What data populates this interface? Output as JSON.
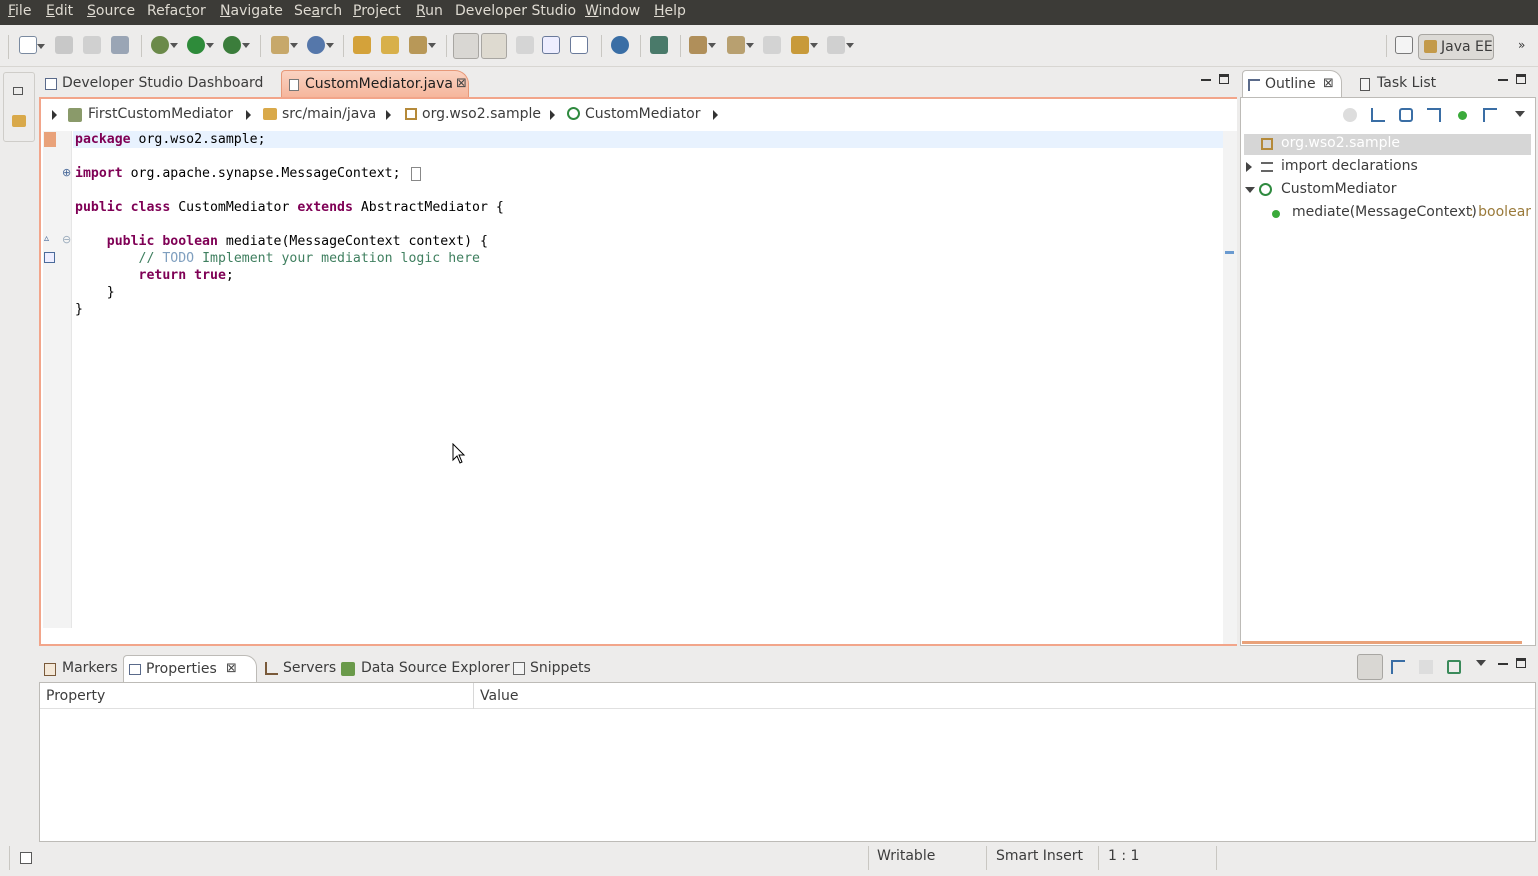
{
  "menubar": {
    "items": [
      {
        "label": "File",
        "mnemonic": "F"
      },
      {
        "label": "Edit",
        "mnemonic": "E"
      },
      {
        "label": "Source",
        "mnemonic": "S"
      },
      {
        "label": "Refactor",
        "mnemonic": "t"
      },
      {
        "label": "Navigate",
        "mnemonic": "N"
      },
      {
        "label": "Search",
        "mnemonic": "a"
      },
      {
        "label": "Project",
        "mnemonic": "P"
      },
      {
        "label": "Run",
        "mnemonic": "R"
      },
      {
        "label": "Developer Studio",
        "mnemonic": ""
      },
      {
        "label": "Window",
        "mnemonic": "W"
      },
      {
        "label": "Help",
        "mnemonic": "H"
      }
    ]
  },
  "toolbar": {
    "perspective": "Java EE"
  },
  "editor": {
    "tabs": [
      {
        "label": "Developer Studio Dashboard"
      },
      {
        "label": "CustomMediator.java"
      }
    ],
    "breadcrumb": [
      "FirstCustomMediator",
      "src/main/java",
      "org.wso2.sample",
      "CustomMediator"
    ],
    "code": {
      "l1_kw": "package",
      "l1_rest": " org.wso2.sample;",
      "l3_kw": "import",
      "l3_rest": " org.apache.synapse.MessageContext;",
      "l5_kw1": "public",
      "l5_kw2": "class",
      "l5_mid": " CustomMediator ",
      "l5_kw3": "extends",
      "l5_rest": " AbstractMediator {",
      "l7_kw1": "public",
      "l7_kw2": "boolean",
      "l7_rest": " mediate(MessageContext context) {",
      "l8_cm1": "// ",
      "l8_todo": "TODO",
      "l8_cm2": " Implement your mediation logic here",
      "l9_kw": "return",
      "l9_kw2": "true",
      "l9_rest": ";",
      "l10": "}",
      "l11": "}"
    }
  },
  "outline": {
    "tabs": [
      {
        "label": "Outline"
      },
      {
        "label": "Task List"
      }
    ],
    "items": {
      "package": "org.wso2.sample",
      "imports": "import declarations",
      "class": "CustomMediator",
      "method": "mediate(MessageContext)",
      "method_type": " : boolean"
    }
  },
  "bottom": {
    "tabs": [
      {
        "label": "Markers"
      },
      {
        "label": "Properties"
      },
      {
        "label": "Servers"
      },
      {
        "label": "Data Source Explorer"
      },
      {
        "label": "Snippets"
      }
    ],
    "columns": [
      "Property",
      "Value"
    ]
  },
  "status": {
    "writable": "Writable",
    "insert_mode": "Smart Insert",
    "position": "1 : 1"
  },
  "colors": {
    "menubar_bg": "#3c3b37",
    "active_tab": "#f5b59b",
    "keyword": "#7f0055",
    "comment": "#3f7f5f",
    "todo": "#7f9fbf"
  }
}
